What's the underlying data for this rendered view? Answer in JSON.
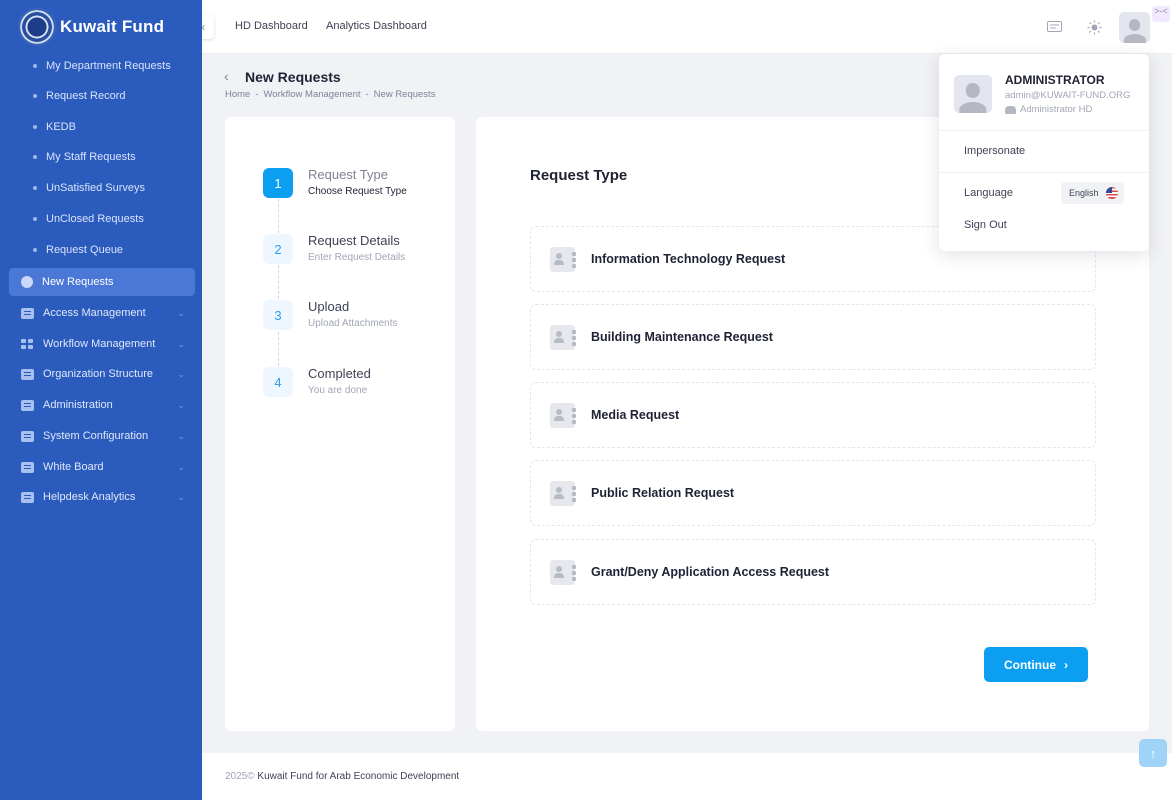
{
  "brand": {
    "name": "Kuwait Fund"
  },
  "topbar": {
    "links": [
      "HD Dashboard",
      "Analytics Dashboard"
    ],
    "icons": [
      "chat-icon",
      "sun-icon",
      "avatar"
    ]
  },
  "sidebar": {
    "sub_items": [
      "My Department Requests",
      "Request Record",
      "KEDB",
      "My Staff Requests",
      "UnSatisfied Surveys",
      "UnClosed Requests",
      "Request Queue"
    ],
    "active_item": "New Requests",
    "groups": [
      "Access Management",
      "Workflow Management",
      "Organization Structure",
      "Administration",
      "System Configuration",
      "White Board",
      "Helpdesk Analytics"
    ]
  },
  "page": {
    "title": "New Requests",
    "breadcrumb": [
      "Home",
      "Workflow Management",
      "New Requests"
    ]
  },
  "stepper": [
    {
      "num": "1",
      "title": "Request Type",
      "desc": "Choose Request Type",
      "state": "current"
    },
    {
      "num": "2",
      "title": "Request Details",
      "desc": "Enter Request Details",
      "state": "pending"
    },
    {
      "num": "3",
      "title": "Upload",
      "desc": "Upload Attachments",
      "state": "pending"
    },
    {
      "num": "4",
      "title": "Completed",
      "desc": "You are done",
      "state": "pending"
    }
  ],
  "main": {
    "section_title": "Request Type",
    "options": [
      "Information Technology Request",
      "Building Maintenance Request",
      "Media Request",
      "Public Relation Request",
      "Grant/Deny Application Access Request"
    ],
    "continue_label": "Continue"
  },
  "user_menu": {
    "name": "ADMINISTRATOR",
    "email": "admin@KUWAIT-FUND.ORG",
    "role": "Administrator HD",
    "impersonate": "Impersonate",
    "language_label": "Language",
    "language_value": "English",
    "sign_out": "Sign Out"
  },
  "footer": {
    "year": "2025©",
    "org": "Kuwait Fund for Arab Economic Development"
  },
  "colors": {
    "sidebar": "#2b5bbd",
    "primary": "#0c9ff1",
    "active_nav": "#4b78d6"
  }
}
